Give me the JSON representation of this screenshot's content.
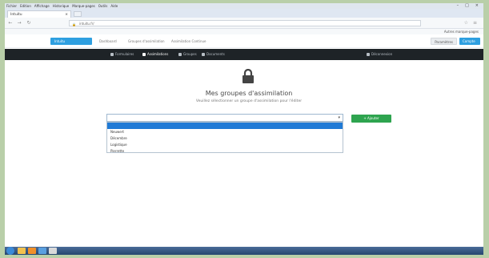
{
  "browser": {
    "menu": [
      "Fichier",
      "Edition",
      "Affichage",
      "Historique",
      "Marque-pages",
      "Outils",
      "Aide"
    ],
    "tab_title": "Intuitu",
    "address": "intuitu.fr/",
    "other_bookmarks": "Autres marque-pages"
  },
  "site": {
    "brand_button": "Intuitu",
    "links": [
      "Dashboard",
      "Groupes d'assimilation",
      "Assimilation Continue"
    ],
    "right_buttons": [
      "Paramètres",
      "Compte"
    ]
  },
  "nav": {
    "items": [
      {
        "label": "Formulaires",
        "active": false
      },
      {
        "label": "Assimilations",
        "active": true
      },
      {
        "label": "Groupes",
        "active": false
      },
      {
        "label": "Documents",
        "active": false
      }
    ],
    "right_item": "Déconnexion"
  },
  "main": {
    "title": "Mes groupes d'assimilation",
    "subtitle": "Veuillez sélectionner un groupe d'assimilation pour l'éditer",
    "select_value": "",
    "options": [
      "",
      "Neuwert",
      "Décembre",
      "Logistique",
      "Pierrette"
    ],
    "highlighted_index": 0,
    "add_button": "+ Ajouter"
  },
  "colors": {
    "primary": "#2e9fe0",
    "success": "#2ea44f",
    "dark_nav": "#1e2327",
    "highlight": "#1f7ad6"
  }
}
